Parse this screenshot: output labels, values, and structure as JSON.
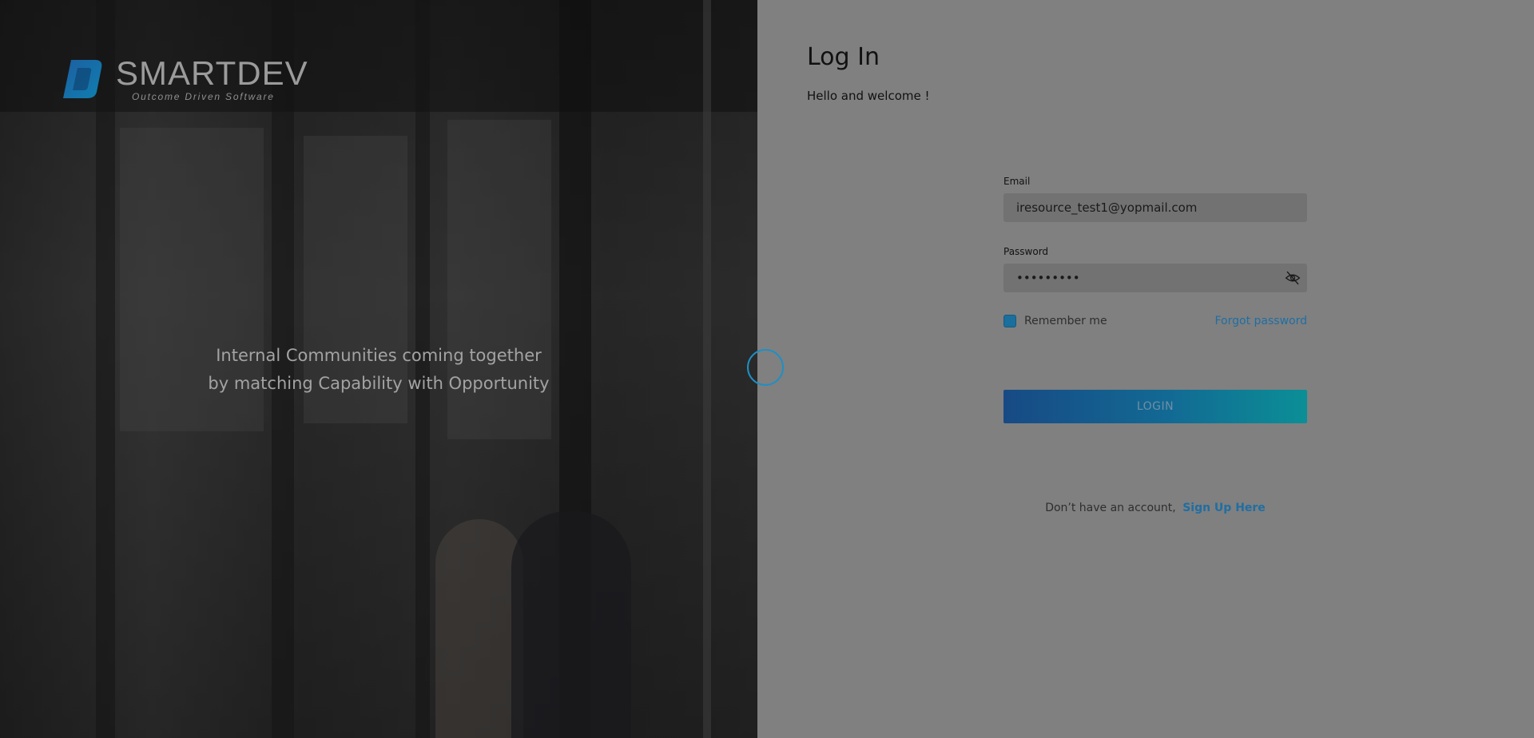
{
  "brand": {
    "name": "SMARTDEV",
    "tagline": "Outcome Driven Software"
  },
  "hero": {
    "line1": "Internal Communities coming together",
    "line2": "by matching Capability with Opportunity"
  },
  "login": {
    "title": "Log In",
    "subtitle": "Hello and welcome !",
    "email_label": "Email",
    "email_value": "iresource_test1@yopmail.com",
    "password_label": "Password",
    "password_value": "•••••••••",
    "remember_label": "Remember me",
    "remember_checked": true,
    "forgot_label": "Forgot password",
    "login_button": "LOGIN",
    "signup_prompt": "Don’t have an account,",
    "signup_link": "Sign Up Here"
  },
  "icons": {
    "password_toggle": "eye-slash-icon",
    "loading": "loading-spinner-icon"
  },
  "colors": {
    "accent": "#1f6ea3",
    "button_gradient_start": "#174a84",
    "button_gradient_end": "#0b8f96",
    "overlay": "#808080"
  }
}
